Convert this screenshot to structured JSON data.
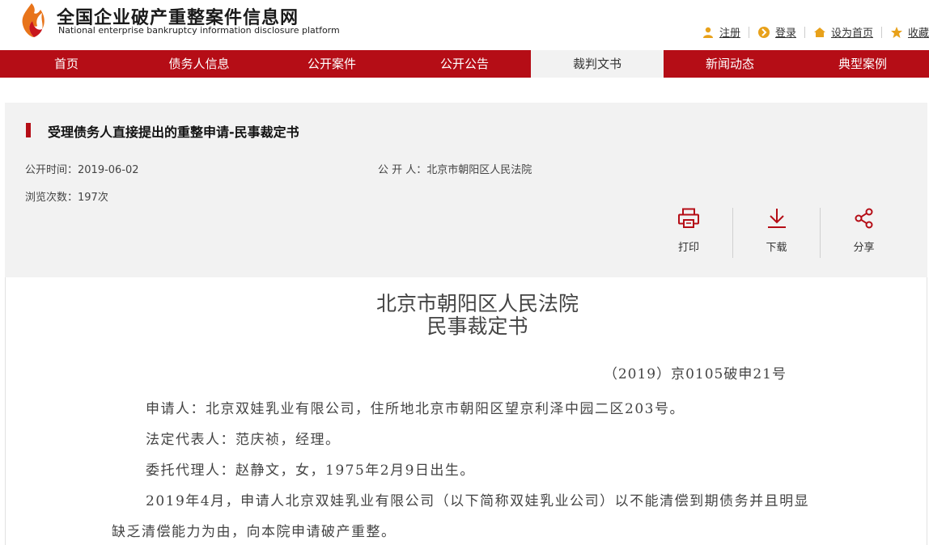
{
  "header": {
    "title": "全国企业破产重整案件信息网",
    "subtitle": "National enterprise bankruptcy  information disclosure platform",
    "links": {
      "register": "注册",
      "login": "登录",
      "set_home": "设为首页",
      "favorite": "收藏"
    }
  },
  "nav": {
    "items": [
      "首页",
      "债务人信息",
      "公开案件",
      "公开公告",
      "裁判文书",
      "新闻动态",
      "典型案例"
    ],
    "active_index": 4
  },
  "info": {
    "title": "受理债务人直接提出的重整申请-民事裁定书",
    "publish_time": "公开时间：2019-06-02",
    "publisher": "公 开 人：北京市朝阳区人民法院",
    "views": "浏览次数：197次",
    "actions": {
      "print": "打印",
      "download": "下载",
      "share": "分享"
    }
  },
  "document": {
    "court": "北京市朝阳区人民法院",
    "doc_type": "民事裁定书",
    "case_number": "（2019）京0105破申21号",
    "paragraphs": [
      "申请人：北京双娃乳业有限公司，住所地北京市朝阳区望京利泽中园二区203号。",
      "法定代表人：范庆祯，经理。",
      "委托代理人：赵静文，女，1975年2月9日出生。",
      "2019年4月，申请人北京双娃乳业有限公司（以下简称双娃乳业公司）以不能清偿到期债务并且明显缺乏清偿能力为由，向本院申请破产重整。"
    ]
  },
  "colors": {
    "brand_red": "#b50d16",
    "panel_bg": "#f2f2f2"
  }
}
